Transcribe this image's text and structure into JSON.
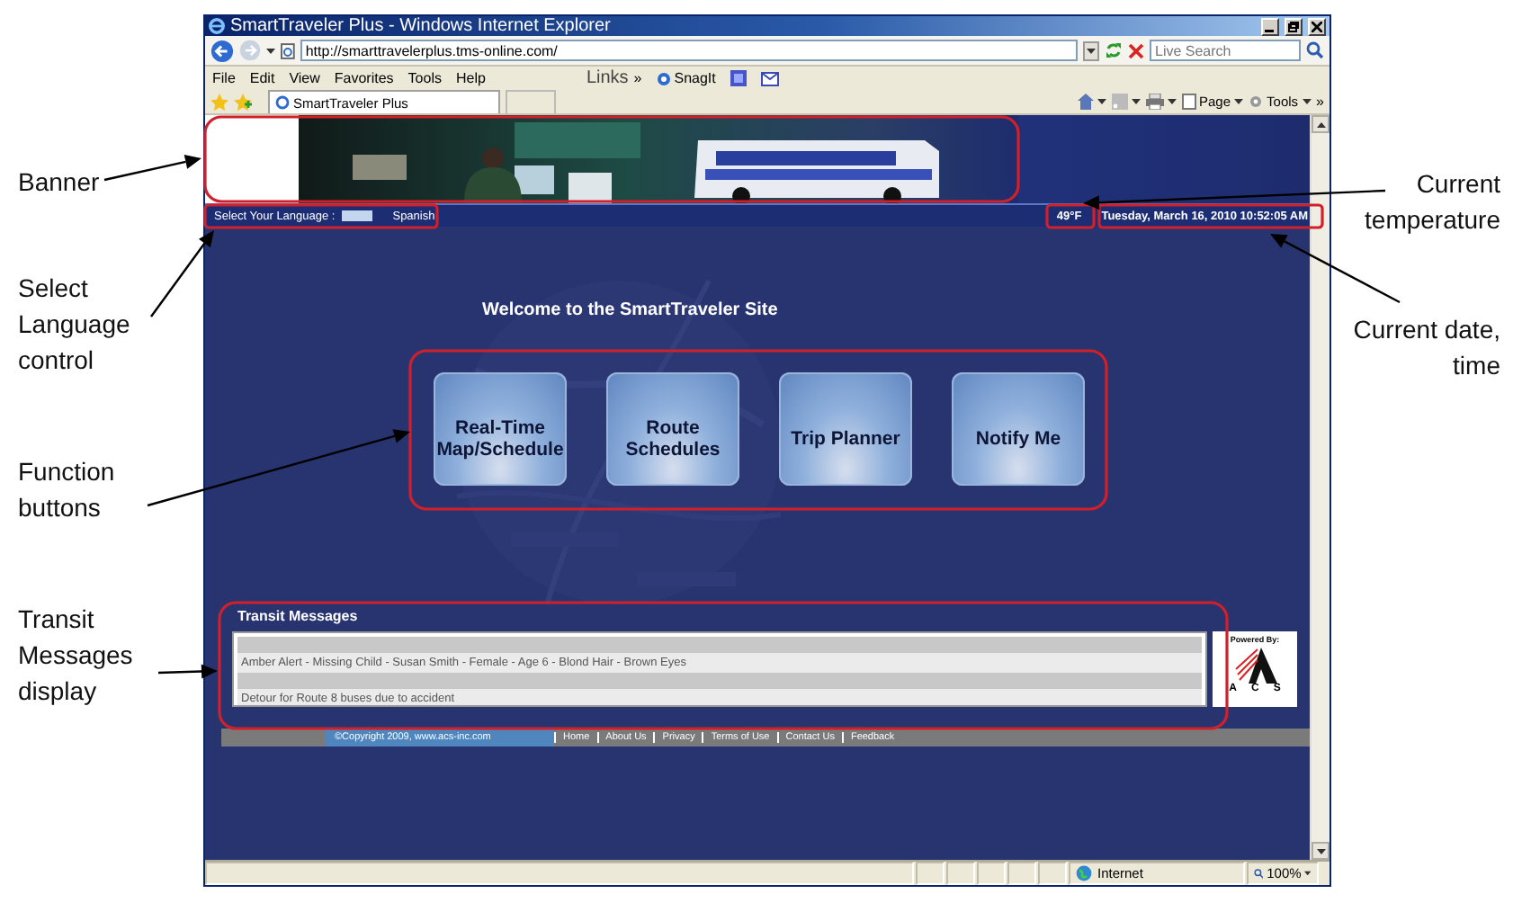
{
  "annotations": [
    {
      "text": "Banner"
    },
    {
      "text": "Select Language control"
    },
    {
      "text": "Function buttons"
    },
    {
      "text": "Transit Messages display"
    },
    {
      "text": "Current temperature"
    },
    {
      "text": "Current date, time"
    }
  ],
  "browser": {
    "title": "SmartTraveler Plus - Windows Internet Explorer",
    "address": "http://smarttravelerplus.tms-online.com/",
    "search": {
      "placeholder": "Live Search"
    },
    "menu": [
      "File",
      "Edit",
      "View",
      "Favorites",
      "Tools",
      "Help"
    ],
    "links_label": "Links",
    "links_more": "»",
    "snagit": "SnagIt",
    "tab": "SmartTraveler Plus",
    "commands": [
      "Page",
      "Tools"
    ],
    "commands_more": "»",
    "status": {
      "zone": "Internet",
      "zoom": "100%"
    }
  },
  "site": {
    "language_label": "Select Your Language :",
    "language_option": "Spanish",
    "temperature": "49°F",
    "datetime": "Tuesday, March 16, 2010 10:52:05 AM",
    "welcome": "Welcome to the SmartTraveler Site",
    "buttons": [
      "Real-Time Map/Schedule",
      "Route Schedules",
      "Trip Planner",
      "Notify Me"
    ],
    "transit": {
      "title": "Transit Messages",
      "messages": [
        "Amber Alert - Missing Child - Susan Smith - Female - Age 6 - Blond Hair - Brown Eyes",
        "Detour for Route 8 buses due to accident"
      ]
    },
    "powered_by": "Powered By:",
    "logo": "ACS",
    "copyright": "©Copyright 2009, www.acs-inc.com",
    "footer_links": [
      "Home",
      "About Us",
      "Privacy",
      "Terms of Use",
      "Contact Us",
      "Feedback"
    ]
  }
}
